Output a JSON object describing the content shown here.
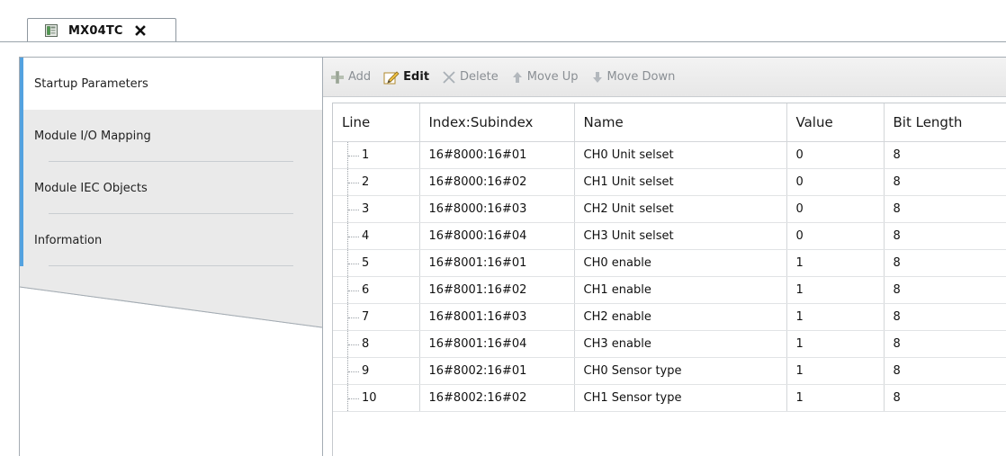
{
  "document_tab": {
    "title": "MX04TC",
    "close_icon": "close-icon",
    "icon": "device-icon"
  },
  "side_tabs": [
    {
      "label": "Startup Parameters",
      "active": true
    },
    {
      "label": "Module I/O Mapping",
      "active": false
    },
    {
      "label": "Module IEC Objects",
      "active": false
    },
    {
      "label": "Information",
      "active": false
    }
  ],
  "toolbar": {
    "add_label": "Add",
    "edit_label": "Edit",
    "delete_label": "Delete",
    "move_up_label": "Move Up",
    "move_down_label": "Move Down"
  },
  "table": {
    "headers": [
      "Line",
      "Index:Subindex",
      "Name",
      "Value",
      "Bit Length"
    ],
    "rows": [
      [
        "1",
        "16#8000:16#01",
        "CH0 Unit selset",
        "0",
        "8"
      ],
      [
        "2",
        "16#8000:16#02",
        "CH1 Unit selset",
        "0",
        "8"
      ],
      [
        "3",
        "16#8000:16#03",
        "CH2 Unit selset",
        "0",
        "8"
      ],
      [
        "4",
        "16#8000:16#04",
        "CH3 Unit selset",
        "0",
        "8"
      ],
      [
        "5",
        "16#8001:16#01",
        "CH0 enable",
        "1",
        "8"
      ],
      [
        "6",
        "16#8001:16#02",
        "CH1 enable",
        "1",
        "8"
      ],
      [
        "7",
        "16#8001:16#03",
        "CH2 enable",
        "1",
        "8"
      ],
      [
        "8",
        "16#8001:16#04",
        "CH3 enable",
        "1",
        "8"
      ],
      [
        "9",
        "16#8002:16#01",
        "CH0 Sensor type",
        "1",
        "8"
      ],
      [
        "10",
        "16#8002:16#02",
        "CH1 Sensor type",
        "1",
        "8"
      ]
    ]
  },
  "colors": {
    "accent": "#53a2e0",
    "tab_inactive_bg": "#eaeaea",
    "toolbar_disabled_text": "#8a8f94"
  }
}
